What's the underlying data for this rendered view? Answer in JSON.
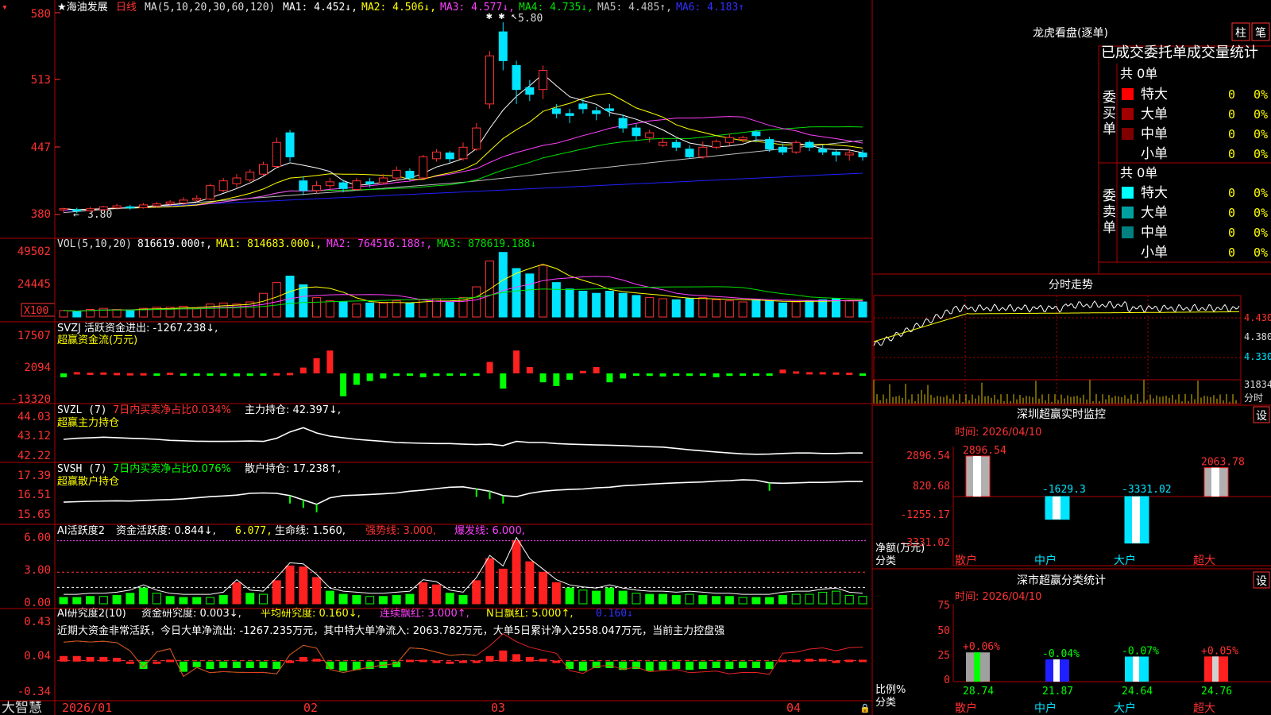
{
  "colors": {
    "up": "#ff3232",
    "down": "#00e5ff",
    "grid": "#b00000",
    "axis": "#ff3232",
    "ma1": "#ffffff",
    "ma2": "#ffff00",
    "ma3": "#ff40ff",
    "ma4": "#00e000",
    "ma5": "#c0c0c0",
    "ma6": "#2020ff",
    "green": "#00ff00",
    "yellow": "#ffff00",
    "gold": "#e0c000"
  },
  "header": {
    "stock": "★海油发展",
    "period": "日线",
    "ma_def": "MA(5,10,20,30,60,120)",
    "ma1": "MA1: 4.452↓,",
    "ma2": "MA2: 4.506↓,",
    "ma3": "MA3: 4.577↓,",
    "ma4": "MA4: 4.735↓,",
    "ma5": "MA5: 4.485↑,",
    "ma6": "MA6: 4.183↑"
  },
  "main": {
    "y_ticks": [
      "580",
      "513",
      "447",
      "380"
    ],
    "high_label": "5.80",
    "low_label": "3.80",
    "ylim": [
      3.8,
      5.8
    ]
  },
  "vol": {
    "title": "VOL(5,10,20)",
    "value": "816619.000↑,",
    "ma1": "MA1: 814683.000↓,",
    "ma2": "MA2: 764516.188↑,",
    "ma3": "MA3: 878619.188↓",
    "y_ticks": [
      "49502",
      "24445"
    ],
    "unit": "X100"
  },
  "svzj": {
    "title": "SVZJ  活跃资金进出: -1267.238↓,",
    "subtitle": "超赢资金流(万元)",
    "y_ticks": [
      "17507",
      "2094",
      "-13320"
    ]
  },
  "svzl": {
    "title": "SVZL (7)",
    "pct": "7日内买卖净占比0.034%",
    "hold": "主力持仓: 42.397↓,",
    "subtitle": "超赢主力持仓",
    "y_ticks": [
      "44.03",
      "43.12",
      "42.22"
    ]
  },
  "svsh": {
    "title": "SVSH (7)",
    "pct": "7日内买卖净占比0.076%",
    "hold": "散户持仓: 17.238↑,",
    "subtitle": "超赢散户持仓",
    "y_ticks": [
      "17.39",
      "16.51",
      "15.65"
    ]
  },
  "ai1": {
    "title": "AI活跃度2",
    "a": "资金活跃度: 0.844↓,",
    "b": "6.077,",
    "c": "生命线: 1.560,",
    "d": "强势线: 3.000,",
    "e": "爆发线: 6.000,",
    "y_ticks": [
      "6.00",
      "3.00",
      "0.00"
    ]
  },
  "ai2": {
    "title": "AI研究度2(10)",
    "a": "资金研究度: 0.003↓,",
    "b": "平均研究度: 0.160↓,",
    "c": "连续飘红: 3.000↑,",
    "d": "N日飘红: 5.000↑,",
    "e": "0.160↓",
    "note": "近期大资金非常活跃，今日大单净流出: -1267.235万元，其中特大单净流入: 2063.782万元，大单5日累计净入2558.047万元，当前主力控盘强",
    "y_ticks": [
      "0.43",
      "0.04",
      "-0.34"
    ]
  },
  "footer": {
    "brand": "大智慧",
    "dates": [
      "2026/01",
      "02",
      "03",
      "04"
    ]
  },
  "lhb": {
    "title": "龙虎看盘(逐单)",
    "btn1": "柱",
    "btn2": "笔",
    "header": "已成交委托单成交量统计",
    "buy_label": [
      "委",
      "买",
      "单"
    ],
    "sell_label": [
      "委",
      "卖",
      "单"
    ],
    "buy_total": "共 0单",
    "sell_total": "共 0单",
    "buy_rows": [
      {
        "name": "特大",
        "val": "0",
        "pct": "0%",
        "color": "#ff0000"
      },
      {
        "name": "大单",
        "val": "0",
        "pct": "0%",
        "color": "#a00000"
      },
      {
        "name": "中单",
        "val": "0",
        "pct": "0%",
        "color": "#800000"
      },
      {
        "name": "小单",
        "val": "0",
        "pct": "0%",
        "color": ""
      }
    ],
    "sell_rows": [
      {
        "name": "特大",
        "val": "0",
        "pct": "0%",
        "color": "#00ffff"
      },
      {
        "name": "大单",
        "val": "0",
        "pct": "0%",
        "color": "#00a0a0"
      },
      {
        "name": "中单",
        "val": "0",
        "pct": "0%",
        "color": "#008080"
      },
      {
        "name": "小单",
        "val": "0",
        "pct": "0%",
        "color": ""
      }
    ]
  },
  "fenshi": {
    "title": "分时走势",
    "y_ticks": [
      "4.430",
      "4.380",
      "4.330"
    ],
    "vol_tick": "31834",
    "unit": "分时"
  },
  "monitor": {
    "title": "深圳超赢实时监控",
    "set": "设",
    "time": "时间: 2026/04/10",
    "y_ticks": [
      "2896.54",
      "820.68",
      "-1255.17",
      "-3331.02"
    ],
    "ylabel1": "净额(万元)",
    "ylabel2": "分类",
    "cats": [
      "散户",
      "中户",
      "大户",
      "超大"
    ],
    "value_labels": [
      "2896.54",
      "-1629.3",
      "-3331.02",
      "2063.78"
    ]
  },
  "classify": {
    "title": "深市超赢分类统计",
    "set": "设",
    "time": "时间: 2026/04/10",
    "y_ticks": [
      "75",
      "50",
      "25",
      "0"
    ],
    "ylabel1": "比例%",
    "ylabel2": "分类",
    "cats": [
      "散户",
      "中户",
      "大户",
      "超大"
    ],
    "changes": [
      "+0.06%",
      "-0.04%",
      "-0.07%",
      "+0.05%"
    ],
    "values": [
      "28.74",
      "21.87",
      "24.64",
      "24.76"
    ]
  },
  "chart_data": [
    {
      "type": "candlestick",
      "ylim": [
        3.8,
        5.8
      ],
      "ohlc": [
        [
          3.85,
          3.86,
          3.82,
          3.87
        ],
        [
          3.85,
          3.84,
          3.81,
          3.87
        ],
        [
          3.84,
          3.86,
          3.82,
          3.88
        ],
        [
          3.85,
          3.88,
          3.84,
          3.89
        ],
        [
          3.87,
          3.89,
          3.85,
          3.91
        ],
        [
          3.88,
          3.87,
          3.85,
          3.9
        ],
        [
          3.87,
          3.9,
          3.86,
          3.92
        ],
        [
          3.89,
          3.91,
          3.87,
          3.93
        ],
        [
          3.91,
          3.93,
          3.89,
          3.95
        ],
        [
          3.92,
          3.95,
          3.9,
          3.98
        ],
        [
          3.95,
          3.97,
          3.93,
          4.0
        ],
        [
          3.96,
          4.1,
          3.95,
          4.12
        ],
        [
          4.05,
          4.15,
          4.03,
          4.18
        ],
        [
          4.12,
          4.18,
          4.08,
          4.22
        ],
        [
          4.16,
          4.24,
          4.14,
          4.27
        ],
        [
          4.22,
          4.32,
          4.2,
          4.35
        ],
        [
          4.3,
          4.55,
          4.28,
          4.6
        ],
        [
          4.65,
          4.4,
          4.35,
          4.68
        ],
        [
          4.15,
          4.05,
          4.0,
          4.2
        ],
        [
          4.05,
          4.1,
          4.02,
          4.15
        ],
        [
          4.1,
          4.14,
          4.06,
          4.18
        ],
        [
          4.13,
          4.07,
          4.03,
          4.16
        ],
        [
          4.06,
          4.15,
          4.05,
          4.18
        ],
        [
          4.14,
          4.12,
          4.08,
          4.18
        ],
        [
          4.13,
          4.18,
          4.11,
          4.22
        ],
        [
          4.18,
          4.26,
          4.15,
          4.3
        ],
        [
          4.25,
          4.18,
          4.15,
          4.28
        ],
        [
          4.18,
          4.4,
          4.17,
          4.42
        ],
        [
          4.38,
          4.45,
          4.35,
          4.48
        ],
        [
          4.44,
          4.38,
          4.34,
          4.46
        ],
        [
          4.38,
          4.5,
          4.36,
          4.55
        ],
        [
          4.48,
          4.7,
          4.46,
          4.75
        ],
        [
          4.95,
          5.45,
          4.9,
          5.5
        ],
        [
          5.7,
          5.4,
          5.3,
          5.8
        ],
        [
          5.35,
          5.1,
          4.95,
          5.4
        ],
        [
          5.12,
          5.05,
          4.98,
          5.2
        ],
        [
          5.1,
          5.3,
          5.0,
          5.35
        ],
        [
          4.9,
          4.85,
          4.8,
          4.95
        ],
        [
          4.85,
          4.83,
          4.75,
          4.9
        ],
        [
          4.95,
          4.9,
          4.85,
          5.0
        ],
        [
          4.88,
          4.85,
          4.78,
          4.92
        ],
        [
          4.9,
          4.88,
          4.82,
          4.95
        ],
        [
          4.8,
          4.7,
          4.65,
          4.84
        ],
        [
          4.7,
          4.62,
          4.56,
          4.74
        ],
        [
          4.6,
          4.65,
          4.55,
          4.68
        ],
        [
          4.52,
          4.55,
          4.5,
          4.6
        ],
        [
          4.55,
          4.5,
          4.46,
          4.58
        ],
        [
          4.48,
          4.4,
          4.38,
          4.52
        ],
        [
          4.4,
          4.5,
          4.38,
          4.56
        ],
        [
          4.5,
          4.56,
          4.48,
          4.58
        ],
        [
          4.55,
          4.6,
          4.52,
          4.64
        ],
        [
          4.58,
          4.6,
          4.55,
          4.62
        ],
        [
          4.66,
          4.62,
          4.55,
          4.68
        ],
        [
          4.58,
          4.48,
          4.45,
          4.61
        ],
        [
          4.5,
          4.45,
          4.42,
          4.54
        ],
        [
          4.45,
          4.55,
          4.43,
          4.57
        ],
        [
          4.55,
          4.5,
          4.46,
          4.57
        ],
        [
          4.48,
          4.45,
          4.42,
          4.52
        ],
        [
          4.45,
          4.42,
          4.35,
          4.47
        ],
        [
          4.42,
          4.44,
          4.36,
          4.48
        ],
        [
          4.44,
          4.4,
          4.36,
          4.47
        ]
      ]
    },
    {
      "type": "bar",
      "name": "VOL",
      "values": [
        6,
        5,
        7,
        8,
        7,
        6,
        8,
        9,
        9,
        10,
        8,
        12,
        13,
        12,
        14,
        22,
        32,
        38,
        30,
        18,
        15,
        14,
        12,
        13,
        13,
        15,
        13,
        16,
        17,
        14,
        18,
        28,
        52,
        60,
        45,
        40,
        48,
        32,
        26,
        24,
        22,
        24,
        22,
        20,
        18,
        17,
        16,
        17,
        18,
        16,
        15,
        14,
        16,
        15,
        13,
        14,
        15,
        16,
        17,
        15,
        14
      ]
    },
    {
      "type": "bar",
      "name": "SVZJ",
      "values": [
        -1500,
        500,
        300,
        400,
        200,
        100,
        100,
        -200,
        300,
        -300,
        -200,
        -100,
        -1000,
        -1100,
        -1000,
        -500,
        100,
        200,
        2300,
        6000,
        9000,
        -9000,
        -4500,
        -3000,
        -2000,
        -1000,
        -500,
        -1500,
        -1000,
        -800,
        -500,
        -800,
        4500,
        -6000,
        9000,
        2500,
        -3500,
        -5000,
        -2500,
        1000,
        2500,
        -3500,
        -2000,
        -800,
        -1000,
        -1200,
        -500,
        -1000,
        -800,
        -1500,
        -1000,
        -700,
        -600,
        -800,
        1500,
        800,
        500,
        500,
        400,
        300,
        -200
      ]
    },
    {
      "type": "line",
      "name": "SVZL",
      "ylim": [
        42.22,
        44.03
      ],
      "values": [
        43.05,
        43.1,
        43.12,
        43.15,
        43.13,
        43.1,
        43.08,
        43.05,
        43.0,
        42.98,
        42.96,
        42.95,
        42.95,
        42.96,
        42.97,
        42.95,
        43.1,
        43.4,
        43.6,
        43.35,
        43.2,
        43.12,
        43.05,
        43.0,
        42.95,
        42.9,
        42.88,
        42.86,
        42.85,
        42.85,
        42.82,
        42.8,
        42.82,
        42.75,
        42.95,
        42.9,
        42.9,
        42.85,
        42.82,
        42.8,
        42.78,
        42.77,
        42.75,
        42.72,
        42.7,
        42.68,
        42.62,
        42.55,
        42.5,
        42.45,
        42.4,
        42.36,
        42.34,
        42.35,
        42.38,
        42.4,
        42.4,
        42.38,
        42.38,
        42.4,
        42.4
      ]
    },
    {
      "type": "line",
      "name": "SVSH",
      "ylim": [
        15.65,
        17.39
      ],
      "values": [
        16.3,
        16.32,
        16.34,
        16.35,
        16.36,
        16.35,
        16.38,
        16.4,
        16.42,
        16.45,
        16.5,
        16.55,
        16.58,
        16.62,
        16.7,
        16.72,
        16.7,
        16.6,
        16.4,
        16.2,
        16.5,
        16.6,
        16.62,
        16.65,
        16.68,
        16.72,
        16.8,
        16.85,
        16.92,
        16.98,
        17.0,
        16.9,
        16.8,
        16.6,
        16.55,
        16.7,
        16.8,
        16.85,
        16.88,
        16.9,
        16.95,
        16.98,
        17.05,
        17.08,
        17.12,
        17.15,
        17.18,
        17.2,
        17.22,
        17.26,
        17.28,
        17.32,
        17.3,
        17.18,
        17.16,
        17.18,
        17.2,
        17.2,
        17.22,
        17.24,
        17.24
      ]
    },
    {
      "type": "bar",
      "name": "AI活跃度2",
      "ylim": [
        0,
        6.5
      ],
      "values": [
        0.6,
        0.6,
        0.7,
        0.7,
        0.8,
        1.0,
        1.5,
        1.0,
        0.7,
        0.6,
        0.6,
        0.6,
        0.8,
        2.0,
        1.0,
        0.9,
        2.2,
        3.6,
        3.5,
        2.5,
        1.2,
        0.9,
        0.8,
        0.7,
        0.7,
        0.8,
        0.9,
        2.0,
        1.8,
        1.0,
        0.8,
        2.2,
        4.3,
        3.3,
        6.0,
        4.0,
        3.0,
        2.0,
        1.5,
        1.3,
        1.2,
        1.5,
        1.2,
        1.0,
        0.9,
        0.9,
        0.8,
        0.9,
        0.8,
        0.7,
        0.7,
        0.6,
        0.6,
        0.6,
        0.8,
        0.9,
        0.9,
        1.1,
        1.2,
        0.8,
        0.7
      ]
    },
    {
      "type": "bar",
      "name": "AI研究度2(10)",
      "ylim": [
        -0.34,
        0.43
      ],
      "values": [
        0.09,
        0.09,
        0.08,
        0.08,
        0.07,
        0.03,
        -0.05,
        0.03,
        0.05,
        -0.08,
        -0.03,
        -0.05,
        -0.04,
        -0.04,
        -0.04,
        -0.04,
        -0.05,
        0.04,
        0.08,
        0.06,
        -0.05,
        -0.07,
        -0.06,
        -0.05,
        -0.04,
        -0.03,
        0.05,
        0.05,
        0.04,
        0.03,
        0.04,
        0.04,
        0.09,
        0.15,
        0.11,
        0.08,
        0.06,
        0.04,
        -0.05,
        -0.07,
        -0.04,
        -0.04,
        -0.06,
        -0.05,
        -0.07,
        -0.06,
        -0.05,
        -0.06,
        -0.05,
        -0.04,
        -0.05,
        -0.04,
        -0.04,
        -0.05,
        0.05,
        0.05,
        0.06,
        0.06,
        0.04,
        0.05,
        0.05
      ]
    },
    {
      "type": "bar",
      "name": "深圳超赢实时监控",
      "categories": [
        "散户",
        "中户",
        "大户",
        "超大"
      ],
      "values": [
        2896.54,
        -1629.3,
        -3331.02,
        2063.78
      ]
    },
    {
      "type": "bar",
      "name": "深市超赢分类统计",
      "categories": [
        "散户",
        "中户",
        "大户",
        "超大"
      ],
      "values": [
        28.74,
        21.87,
        24.64,
        24.76
      ]
    }
  ]
}
